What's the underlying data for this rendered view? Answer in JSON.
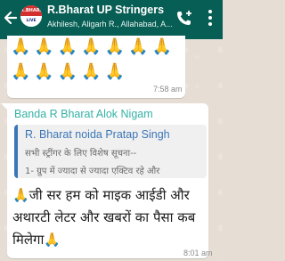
{
  "header": {
    "title": "R.Bharat UP Stringers",
    "subtitle": "Akhilesh, Aligarh R., Allahabad, A...",
    "avatar_top": "R.BHARAT",
    "avatar_bottom": "LIVE NOW",
    "bg_color": "#075e54"
  },
  "messages": [
    {
      "emoji_row_1": "🙏🙏🙏🙏🙏🙏🙏",
      "emoji_row_2": "🙏🙏🙏🙏🙏",
      "time": "7:58 am"
    },
    {
      "sender": "Banda R Bharat Alok Nigam",
      "quote_author": "R. Bharat noida Pratap Singh",
      "quote_line_1": "सभी स्ट्रींगर के लिए विशेष सूचना--",
      "quote_line_2": "1- ग्रुप में ज्यादा से ज्यादा एक्टिव रहे और",
      "text": "🙏जी सर हम को माइक आईडी और अथारटी लेटर और खबरों का पैसा कब मिलेगा🙏",
      "time": "8:01 am"
    }
  ],
  "colors": {
    "sender": "#35b2a6",
    "quote_author": "#3a76b8",
    "chat_bg": "#e6ddd4"
  }
}
